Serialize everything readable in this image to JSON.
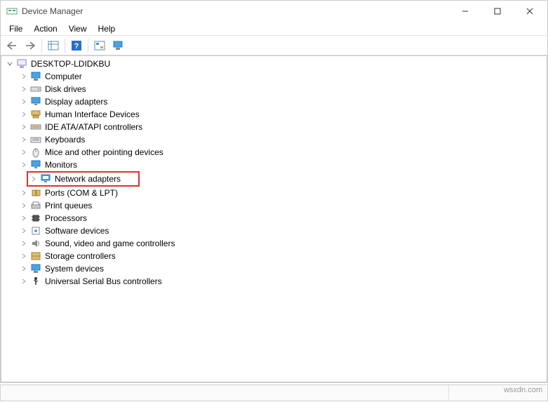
{
  "window": {
    "title": "Device Manager"
  },
  "menu": {
    "file": "File",
    "action": "Action",
    "view": "View",
    "help": "Help"
  },
  "tree": {
    "root": "DESKTOP-LDIDKBU",
    "items": [
      "Computer",
      "Disk drives",
      "Display adapters",
      "Human Interface Devices",
      "IDE ATA/ATAPI controllers",
      "Keyboards",
      "Mice and other pointing devices",
      "Monitors",
      "Network adapters",
      "Ports (COM & LPT)",
      "Print queues",
      "Processors",
      "Software devices",
      "Sound, video and game controllers",
      "Storage controllers",
      "System devices",
      "Universal Serial Bus controllers"
    ]
  },
  "watermark": "wsxdn.com"
}
